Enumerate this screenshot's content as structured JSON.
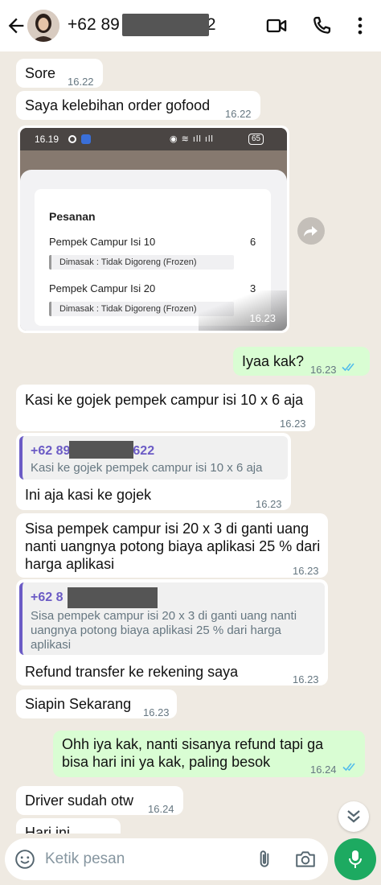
{
  "header": {
    "contact_prefix": "+62 89",
    "contact_suffix": "2"
  },
  "messages": [
    {
      "id": "m1",
      "dir": "in",
      "text": "Sore",
      "time": "16.22"
    },
    {
      "id": "m2",
      "dir": "in",
      "text": "Saya kelebihan order gofood",
      "time": "16.22"
    },
    {
      "id": "m3",
      "dir": "in",
      "type": "image",
      "time": "16.23",
      "screenshot": {
        "status_time": "16.19",
        "battery": "65",
        "title": "Pesanan",
        "items": [
          {
            "name": "Pempek Campur Isi 10",
            "qty": "6",
            "note": "Dimasak : Tidak Digoreng (Frozen)"
          },
          {
            "name": "Pempek Campur Isi 20",
            "qty": "3",
            "note": "Dimasak : Tidak Digoreng (Frozen)"
          }
        ]
      }
    },
    {
      "id": "m4",
      "dir": "out",
      "text": "Iyaa kak?",
      "time": "16.23",
      "read": true
    },
    {
      "id": "m5",
      "dir": "in",
      "text": "Kasi ke gojek pempek campur isi 10 x 6 aja",
      "time": "16.23"
    },
    {
      "id": "m6",
      "dir": "in",
      "text": "Ini aja kasi ke gojek",
      "time": "16.23",
      "quote": {
        "name_prefix": "+62 89",
        "name_suffix": "622",
        "text": "Kasi ke gojek pempek campur isi 10 x 6 aja"
      }
    },
    {
      "id": "m7",
      "dir": "in",
      "text": "Sisa pempek campur isi 20 x 3 di ganti uang nanti uangnya potong biaya aplikasi 25 % dari harga aplikasi",
      "time": "16.23"
    },
    {
      "id": "m8",
      "dir": "in",
      "text": "Refund transfer ke rekening saya",
      "time": "16.23",
      "quote": {
        "name_prefix": "+62 8",
        "text": "Sisa pempek campur isi 20 x 3 di ganti uang nanti uangnya potong biaya aplikasi 25 % dari harga aplikasi"
      }
    },
    {
      "id": "m9",
      "dir": "in",
      "text": "Siapin Sekarang",
      "time": "16.23"
    },
    {
      "id": "m10",
      "dir": "out",
      "text": "Ohh iya kak, nanti sisanya refund tapi ga bisa hari ini ya kak, paling besok",
      "time": "16.24",
      "read": true
    },
    {
      "id": "m11",
      "dir": "in",
      "text": "Driver sudah otw",
      "time": "16.24"
    },
    {
      "id": "m12",
      "dir": "in",
      "text": "Hari ini"
    }
  ],
  "input": {
    "placeholder": "Ketik pesan"
  },
  "colors": {
    "chat_bg": "#efeae2",
    "incoming": "#ffffff",
    "outgoing": "#d9fdd3",
    "read_ticks": "#53bdeb",
    "mic": "#1daa61",
    "quote_accent": "#6b5bc5"
  },
  "icons": [
    "back-arrow-icon",
    "video-call-icon",
    "phone-icon",
    "more-vert-icon",
    "forward-icon",
    "double-check-icon",
    "chevron-double-down-icon",
    "emoji-icon",
    "attach-icon",
    "camera-icon",
    "mic-icon"
  ]
}
